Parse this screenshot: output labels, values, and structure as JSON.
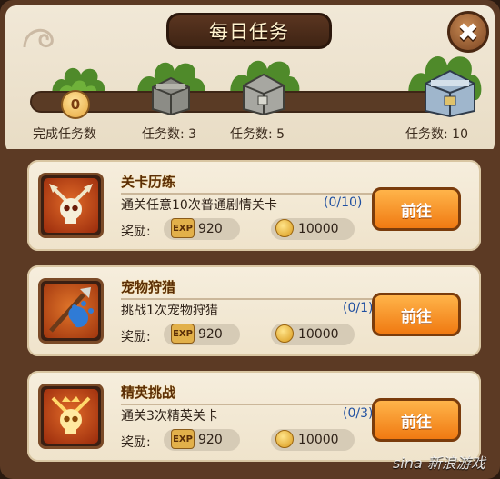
{
  "window": {
    "title": "每日任务",
    "close_glyph": "✖"
  },
  "progress": {
    "current_count": "0",
    "fraction": 0.0
  },
  "milestones": [
    {
      "label": "完成任务数",
      "icon": "none"
    },
    {
      "label": "任务数: 3",
      "icon": "stone-chest-icon"
    },
    {
      "label": "任务数: 5",
      "icon": "silver-chest-icon"
    },
    {
      "label": "任务数: 10",
      "icon": "blue-chest-icon"
    }
  ],
  "tasks": [
    {
      "title": "关卡历练",
      "description": "通关任意10次普通剧情关卡",
      "progress": "(0/10)",
      "reward_label": "奖励:",
      "exp_label": "EXP",
      "exp": "920",
      "coins": "10000",
      "button": "前往",
      "icon": "skull-spears-icon"
    },
    {
      "title": "宠物狩猎",
      "description": "挑战1次宠物狩猎",
      "progress": "(0/1)",
      "reward_label": "奖励:",
      "exp_label": "EXP",
      "exp": "920",
      "coins": "10000",
      "button": "前往",
      "icon": "spear-paw-icon"
    },
    {
      "title": "精英挑战",
      "description": "通关3次精英关卡",
      "progress": "(0/3)",
      "reward_label": "奖励:",
      "exp_label": "EXP",
      "exp": "920",
      "coins": "10000",
      "button": "前往",
      "icon": "golden-skull-icon"
    }
  ],
  "watermark": "sina 新浪游戏",
  "colors": {
    "frame": "#5c3a24",
    "panel": "#f1e8d7",
    "button": "#f07a12",
    "progress_text": "#1f4fa0"
  }
}
